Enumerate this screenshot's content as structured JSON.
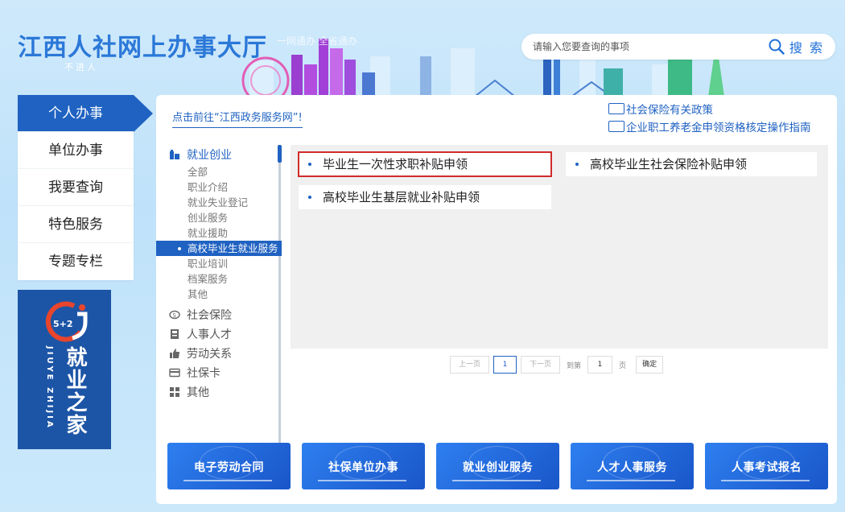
{
  "header": {
    "site_title": "江西人社网上办事大厅",
    "slogan": "一网通办 全省通办",
    "subtitle": "不进人",
    "search_placeholder": "请输入您要查询的事项",
    "search_label": "搜 索"
  },
  "leftnav": {
    "items": [
      {
        "label": "个人办事",
        "active": true
      },
      {
        "label": "单位办事"
      },
      {
        "label": "我要查询"
      },
      {
        "label": "特色服务"
      },
      {
        "label": "专题专栏"
      }
    ],
    "banner": {
      "logo_text": "5+2",
      "title": "就业之家",
      "pinyin": "JIUYE ZHIJIA"
    }
  },
  "main": {
    "gov_link": "点击前往“江西政务服务网”!",
    "policy_links": [
      "社会保险有关政策",
      "企业职工养老金申领资格核定操作指南"
    ],
    "categories": [
      {
        "label": "就业创业",
        "icon": "building-icon",
        "sub": [
          "全部",
          "职业介绍",
          "就业失业登记",
          "创业服务",
          "就业援助",
          "高校毕业生就业服务",
          "职业培训",
          "档案服务",
          "其他"
        ],
        "active_sub": "高校毕业生就业服务"
      },
      {
        "label": "社会保险",
        "icon": "shield-icon"
      },
      {
        "label": "人事人才",
        "icon": "id-card-icon"
      },
      {
        "label": "劳动关系",
        "icon": "thumbs-up-icon"
      },
      {
        "label": "社保卡",
        "icon": "card-icon"
      },
      {
        "label": "其他",
        "icon": "grid-icon"
      }
    ],
    "services": [
      "毕业生一次性求职补贴申领",
      "高校毕业生社会保险补贴申领",
      "高校毕业生基层就业补贴申领"
    ],
    "pager": {
      "prev": "上一页",
      "current": "1",
      "next": "下一页",
      "goto_label": "到第",
      "page_value": "1",
      "page_unit": "页",
      "confirm": "确定"
    },
    "bottom_banners": [
      "电子劳动合同",
      "社保单位办事",
      "就业创业服务",
      "人才人事服务",
      "人事考试报名"
    ]
  },
  "colors": {
    "primary": "#1f62c2",
    "highlight": "#d12b2b",
    "title": "#2b78d8"
  }
}
